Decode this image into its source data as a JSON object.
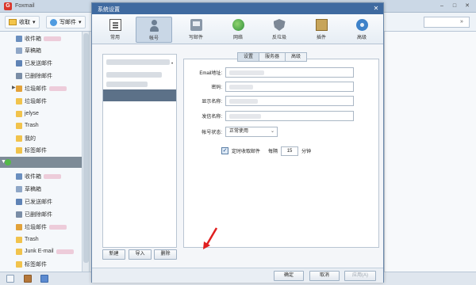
{
  "app": {
    "title": "Foxmail",
    "toolbar": {
      "receive_label": "收取",
      "write_label": "写邮件"
    }
  },
  "folders_top": [
    {
      "label": "收件箱",
      "icon": "inbox-icon"
    },
    {
      "label": "草稿箱",
      "icon": "draft-icon"
    },
    {
      "label": "已发送邮件",
      "icon": "sent-icon"
    },
    {
      "label": "已删除邮件",
      "icon": "trash-icon"
    },
    {
      "label": "垃圾邮件",
      "icon": "junk-icon"
    },
    {
      "label": "垃圾邮件",
      "icon": "folder-icon"
    },
    {
      "label": "jelyse",
      "icon": "folder-icon"
    },
    {
      "label": "Trash",
      "icon": "folder-icon"
    },
    {
      "label": "我的",
      "icon": "folder-icon"
    },
    {
      "label": "标签邮件",
      "icon": "folder-icon"
    }
  ],
  "folders_bottom": [
    {
      "label": "收件箱",
      "icon": "inbox-icon"
    },
    {
      "label": "草稿箱",
      "icon": "draft-icon"
    },
    {
      "label": "已发送邮件",
      "icon": "sent-icon"
    },
    {
      "label": "已删除邮件",
      "icon": "trash-icon"
    },
    {
      "label": "垃圾邮件",
      "icon": "junk-icon"
    },
    {
      "label": "Trash",
      "icon": "folder-icon"
    },
    {
      "label": "Junk E-mail",
      "icon": "folder-icon"
    },
    {
      "label": "标签邮件",
      "icon": "folder-icon"
    }
  ],
  "dialog": {
    "title": "系统设置",
    "tabs": [
      {
        "label": "常用",
        "icon": "common-icon"
      },
      {
        "label": "帐号",
        "icon": "account-icon"
      },
      {
        "label": "写邮件",
        "icon": "write-icon"
      },
      {
        "label": "网络",
        "icon": "network-icon"
      },
      {
        "label": "反垃圾",
        "icon": "antispam-icon"
      },
      {
        "label": "插件",
        "icon": "plugin-icon"
      },
      {
        "label": "高级",
        "icon": "advanced-icon"
      }
    ],
    "active_tab": "帐号",
    "subtabs": [
      "设置",
      "服务器",
      "高级"
    ],
    "fields": {
      "email_label": "Email地址:",
      "password_label": "密码:",
      "display_name_label": "显示名称:",
      "sender_name_label": "发信名称:",
      "status_label": "帐号状态:",
      "status_value": "正常使用",
      "auto_receive_label": "定时收取邮件",
      "every_label": "每隔",
      "interval_value": "15",
      "unit_label": "分钟"
    },
    "list_buttons": {
      "new": "新建",
      "import": "导入",
      "delete": "删除"
    },
    "footer": {
      "ok": "确定",
      "cancel": "取消",
      "apply": "应用(A)"
    }
  }
}
